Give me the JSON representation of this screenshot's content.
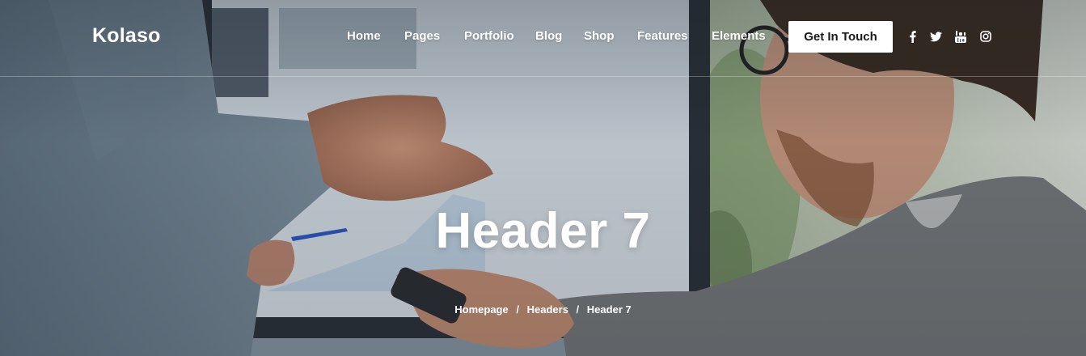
{
  "brand": {
    "name": "Kolaso"
  },
  "nav": {
    "items": [
      {
        "label": "Home"
      },
      {
        "label": "Pages"
      },
      {
        "label": "Portfolio"
      },
      {
        "label": "Blog"
      },
      {
        "label": "Shop"
      },
      {
        "label": "Features"
      },
      {
        "label": "Elements"
      }
    ],
    "cta_label": "Get In Touch"
  },
  "social": [
    {
      "icon": "facebook-icon"
    },
    {
      "icon": "twitter-icon"
    },
    {
      "icon": "youtube-icon"
    },
    {
      "icon": "instagram-icon"
    }
  ],
  "hero": {
    "title": "Header 7"
  },
  "breadcrumb": {
    "items": [
      {
        "label": "Homepage"
      },
      {
        "label": "Headers"
      },
      {
        "label": "Header 7"
      }
    ],
    "separator": "/"
  },
  "colors": {
    "overlay": "#141c24",
    "cta_bg": "#ffffff",
    "cta_text": "#1b1b1b"
  }
}
